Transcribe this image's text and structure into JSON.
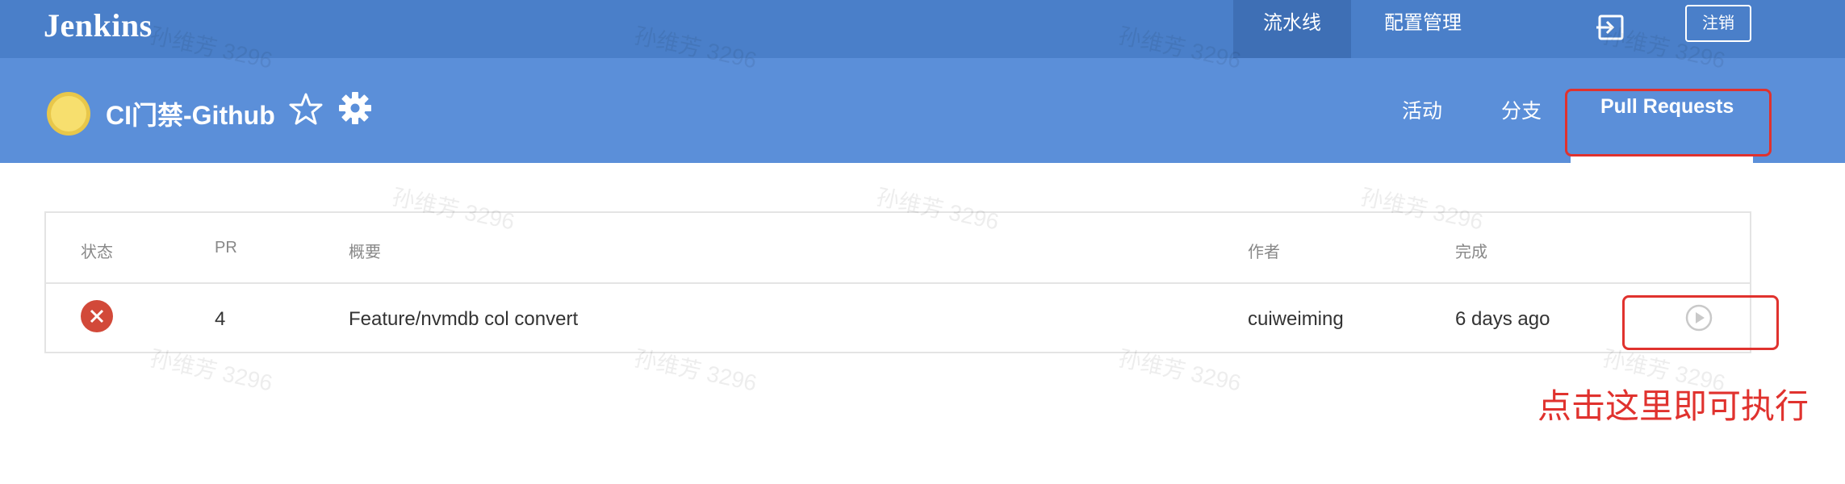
{
  "topbar": {
    "logo": "Jenkins",
    "nav": [
      {
        "label": "流水线",
        "active": true
      },
      {
        "label": "配置管理",
        "active": false
      }
    ],
    "logout_icon": "logout-icon",
    "logout_label": "注销"
  },
  "pipeline": {
    "name": "CI门禁-Github",
    "weather_icon": "sun-icon",
    "tabs": [
      {
        "label": "活动",
        "active": false
      },
      {
        "label": "分支",
        "active": false
      },
      {
        "label": "Pull Requests",
        "active": true
      }
    ]
  },
  "table": {
    "headers": [
      "状态",
      "PR",
      "概要",
      "作者",
      "完成"
    ],
    "rows": [
      {
        "status": "failed",
        "pr": "4",
        "summary": "Feature/nvmdb col convert",
        "author": "cuiweiming",
        "completed": "6 days ago"
      }
    ]
  },
  "annotation": {
    "hint": "点击这里即可执行"
  },
  "watermark": "孙维芳 3296",
  "colors": {
    "topbar": "#4a7fc9",
    "subheader": "#5b8fd9",
    "fail": "#d24939",
    "annotation": "#e0322e"
  }
}
